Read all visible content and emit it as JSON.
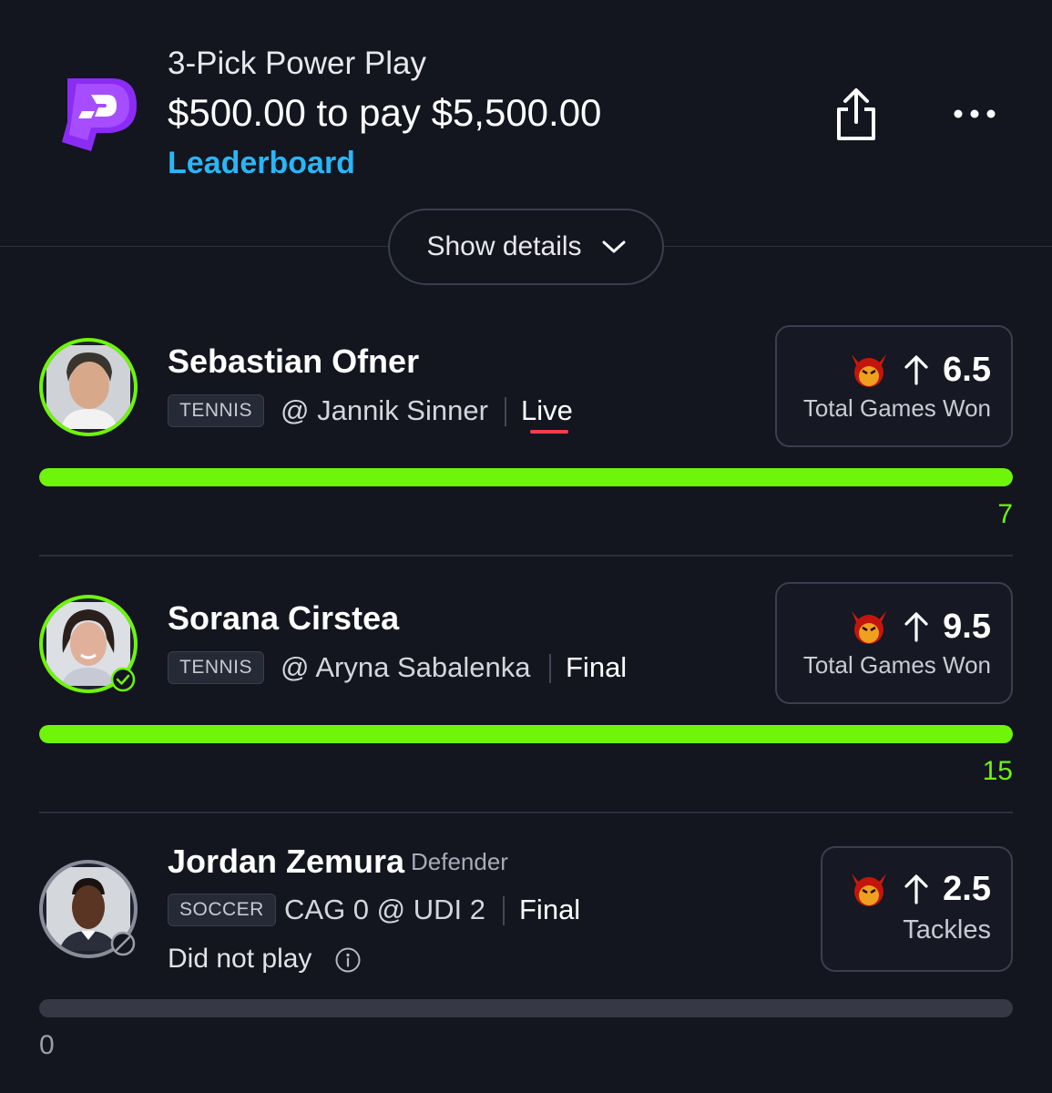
{
  "header": {
    "title": "3-Pick Power Play",
    "stake_text": "$500.00 to pay $5,500.00",
    "leaderboard_label": "Leaderboard",
    "show_details_label": "Show details"
  },
  "colors": {
    "accent_green": "#6ef50a",
    "link_blue": "#29b6f6",
    "live_red": "#ff3b4e",
    "brand_purple": "#8b2cf5"
  },
  "picks": [
    {
      "player": "Sebastian Ofner",
      "position": "",
      "sport": "TENNIS",
      "matchup": "@ Jannik Sinner",
      "status": "Live",
      "line": "6.5",
      "direction": "up-arrow-icon",
      "stat": "Total Games Won",
      "progress_value": "7",
      "progress_fraction": 1.0,
      "note": ""
    },
    {
      "player": "Sorana Cirstea",
      "position": "",
      "sport": "TENNIS",
      "matchup": "@ Aryna Sabalenka",
      "status": "Final",
      "line": "9.5",
      "direction": "up-arrow-icon",
      "stat": "Total Games Won",
      "progress_value": "15",
      "progress_fraction": 1.0,
      "note": ""
    },
    {
      "player": "Jordan Zemura",
      "position": "Defender",
      "sport": "SOCCER",
      "matchup": "CAG 0 @ UDI 2",
      "status": "Final",
      "line": "2.5",
      "direction": "up-arrow-icon",
      "stat": "Tackles",
      "progress_value": "0",
      "progress_fraction": 0.0,
      "note": "Did not play"
    }
  ]
}
